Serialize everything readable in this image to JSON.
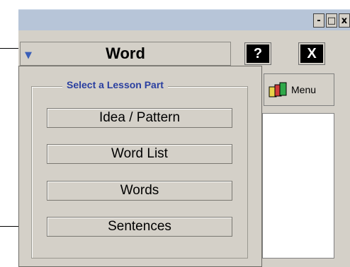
{
  "window_controls": {
    "minimize": "-",
    "maximize": "□",
    "close": "x"
  },
  "header": {
    "title": "Word",
    "help_label": "?",
    "close_label": "X"
  },
  "toolbar": {
    "menu_label": "Menu"
  },
  "popup": {
    "group_title": "Select a Lesson Part",
    "items": [
      {
        "label": "Idea / Pattern"
      },
      {
        "label": "Word List"
      },
      {
        "label": "Words"
      },
      {
        "label": "Sentences"
      }
    ]
  },
  "icons": {
    "dropdown": "triangle-down-icon",
    "menu": "book-stack-icon"
  },
  "colors": {
    "titlebar": "#b7c5d8",
    "panel": "#d4d0c8",
    "group_title": "#2a3fa0",
    "dropdown_arrow": "#3a5fb8"
  }
}
